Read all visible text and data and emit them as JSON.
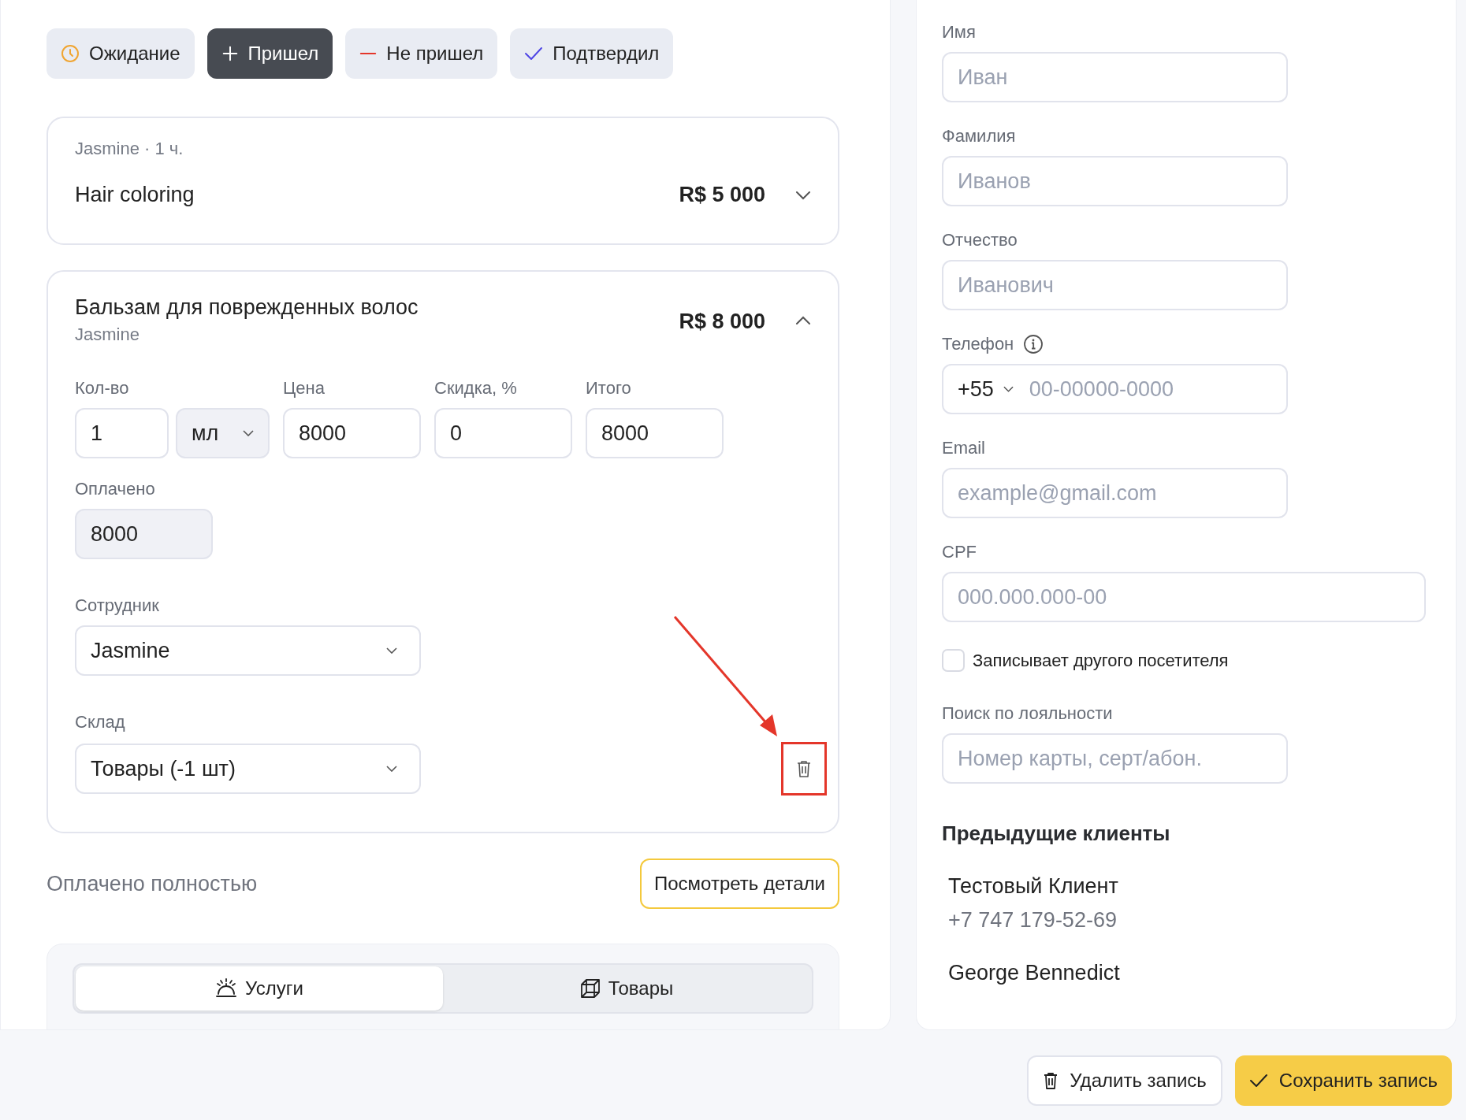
{
  "status_buttons": [
    {
      "label": "Ожидание",
      "kind": "clock",
      "selected": false
    },
    {
      "label": "Пришел",
      "kind": "plus",
      "selected": true
    },
    {
      "label": "Не пришел",
      "kind": "minus",
      "selected": false
    },
    {
      "label": "Подтвердил",
      "kind": "check",
      "selected": false
    }
  ],
  "services": [
    {
      "meta": "Jasmine · 1 ч.",
      "title": "Hair coloring",
      "price": "R$ 5 000",
      "expanded": false
    },
    {
      "meta": "Jasmine",
      "title": "Бальзам для поврежденных волос",
      "price": "R$ 8 000",
      "expanded": true,
      "fields": {
        "qty": {
          "label": "Кол-во",
          "value": "1",
          "unit": "мл"
        },
        "price": {
          "label": "Цена",
          "value": "8000"
        },
        "discount": {
          "label": "Скидка, %",
          "value": "0"
        },
        "total": {
          "label": "Итого",
          "value": "8000"
        },
        "paid": {
          "label": "Оплачено",
          "value": "8000",
          "disabled": true
        },
        "employee": {
          "label": "Сотрудник",
          "value": "Jasmine"
        },
        "warehouse": {
          "label": "Склад",
          "value": "Товары (-1 шт)"
        }
      }
    }
  ],
  "payment_status": "Оплачено полностью",
  "details_button": "Посмотреть детали",
  "tabs": [
    {
      "label": "Услуги",
      "kind": "bell",
      "selected": true
    },
    {
      "label": "Товары",
      "kind": "box",
      "selected": false
    }
  ],
  "client_form": {
    "fields": [
      {
        "label": "Имя",
        "placeholder": "Иван",
        "kind": "text"
      },
      {
        "label": "Фамилия",
        "placeholder": "Иванов",
        "kind": "text"
      },
      {
        "label": "Отчество",
        "placeholder": "Иванович",
        "kind": "text"
      },
      {
        "label": "Телефон",
        "placeholder": "00-00000-0000",
        "kind": "phone",
        "country_code": "+55"
      },
      {
        "label": "Email",
        "placeholder": "example@gmail.com",
        "kind": "text"
      },
      {
        "label": "CPF",
        "placeholder": "000.000.000-00",
        "kind": "wide"
      }
    ],
    "checkbox": {
      "label": "Записывает другого посетителя",
      "checked": false
    },
    "loyalty": {
      "label": "Поиск по лояльности",
      "placeholder": "Номер карты, серт/абон."
    }
  },
  "previous_clients": {
    "title": "Предыдущие клиенты",
    "items": [
      {
        "name": "Тестовый Клиент",
        "phone": "+7 747 179-52-69"
      },
      {
        "name": "George Bennedict"
      }
    ]
  },
  "footer": {
    "delete_button": "Удалить запись",
    "save_button": "Сохранить запись"
  }
}
